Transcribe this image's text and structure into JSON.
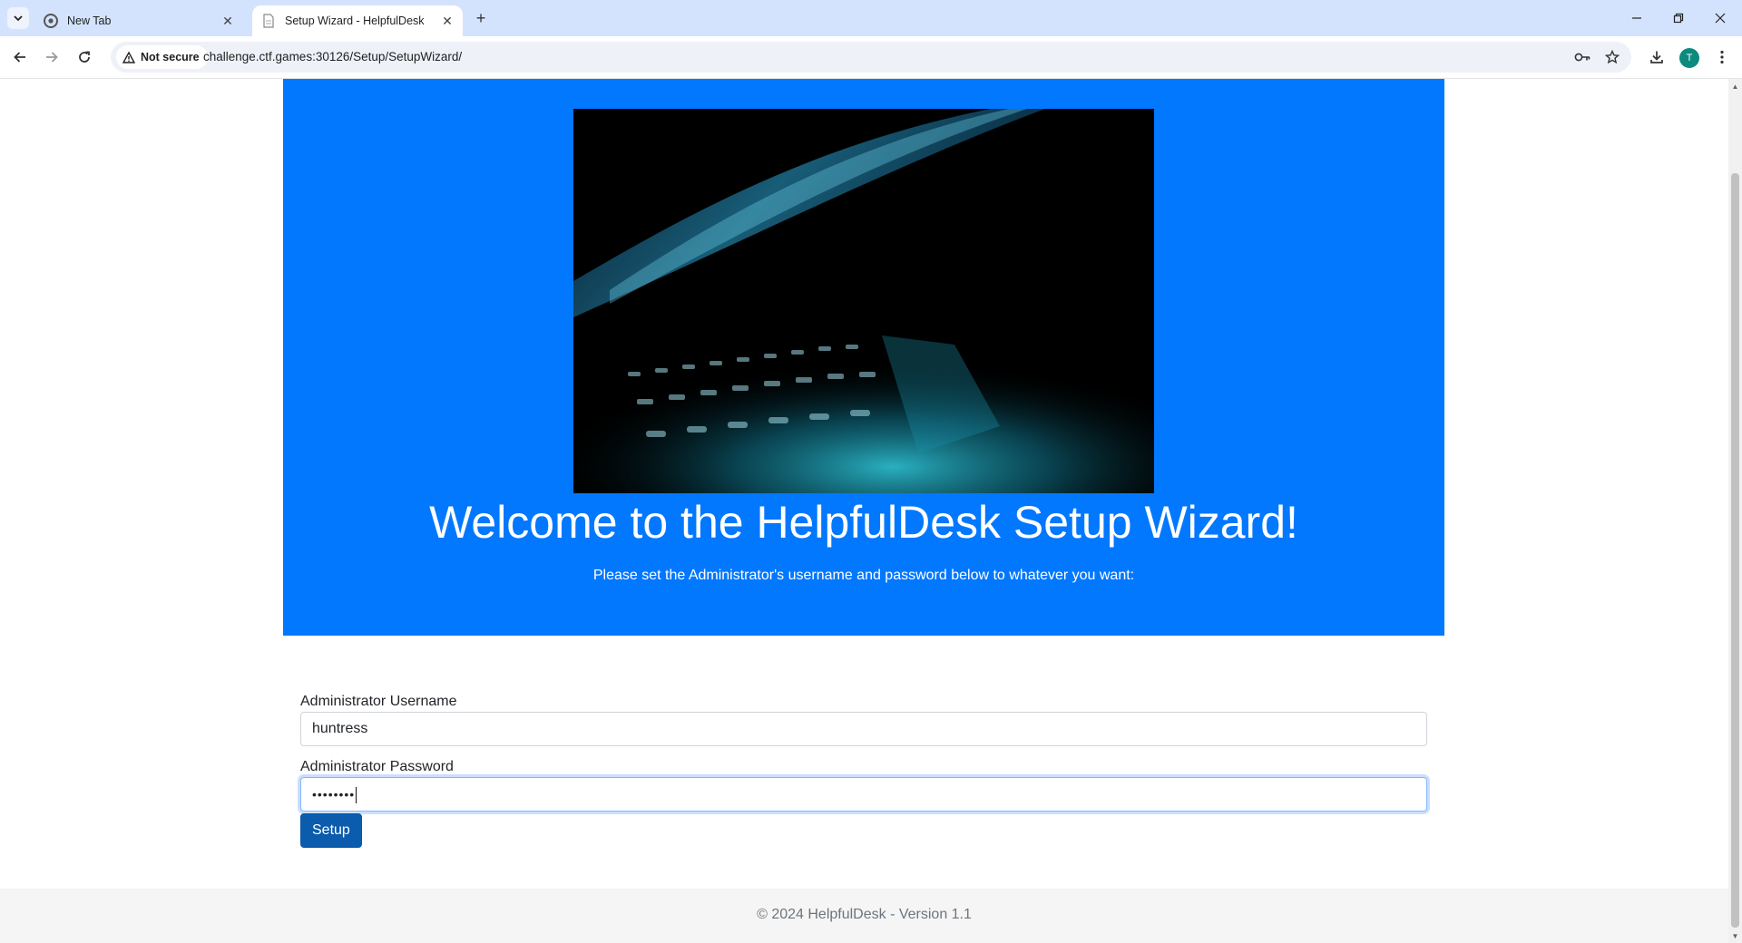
{
  "browser": {
    "tabs": [
      {
        "title": "New Tab",
        "active": false
      },
      {
        "title": "Setup Wizard - HelpfulDesk",
        "active": true
      }
    ],
    "security_label": "Not secure",
    "url": "challenge.ctf.games:30126/Setup/SetupWizard/",
    "profile_initial": "T",
    "icons": [
      "tab-list-icon",
      "chrome-icon",
      "page-icon",
      "close-icon",
      "plus-icon",
      "minimize-icon",
      "restore-icon",
      "window-close-icon",
      "back-icon",
      "forward-icon",
      "reload-icon",
      "warning-icon",
      "key-icon",
      "star-icon",
      "download-icon",
      "menu-icon"
    ]
  },
  "hero": {
    "title": "Welcome to the HelpfulDesk Setup Wizard!",
    "subtitle": "Please set the Administrator's username and password below to whatever you want:",
    "background_color": "#0278ff"
  },
  "form": {
    "username_label": "Administrator Username",
    "username_value": "huntress",
    "password_label": "Administrator Password",
    "password_masked": "••••••••",
    "submit_label": "Setup",
    "button_color": "#0b5cad"
  },
  "footer": {
    "text": "© 2024 HelpfulDesk - Version 1.1"
  }
}
